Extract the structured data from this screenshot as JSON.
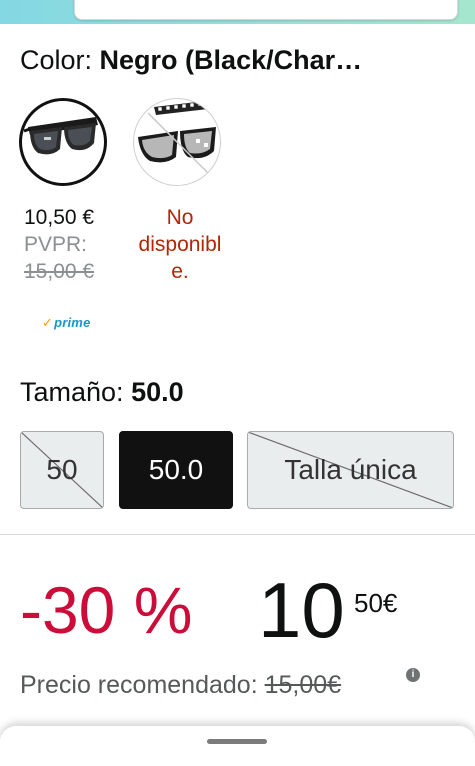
{
  "color": {
    "label": "Color:",
    "value": "Negro (Black/Char…"
  },
  "variants": [
    {
      "price": "10,50 €",
      "pvpr_label": "PVPR:",
      "old_price": "15,00 €",
      "prime": "prime"
    },
    {
      "line1": "No",
      "line2": "disponibl",
      "line3": "e."
    }
  ],
  "size": {
    "label": "Tamaño:",
    "value": "50.0",
    "options": [
      "50",
      "50.0",
      "Talla única"
    ]
  },
  "price": {
    "discount": "-30 %",
    "whole": "10",
    "fraction": "50",
    "currency": "€",
    "recommended_label": "Precio recomendado:",
    "recommended_value": "15,00€",
    "info": "i"
  },
  "colors": {
    "discount": "#cc0c39",
    "unavailable": "#b12704",
    "prime": "#1399c6"
  }
}
